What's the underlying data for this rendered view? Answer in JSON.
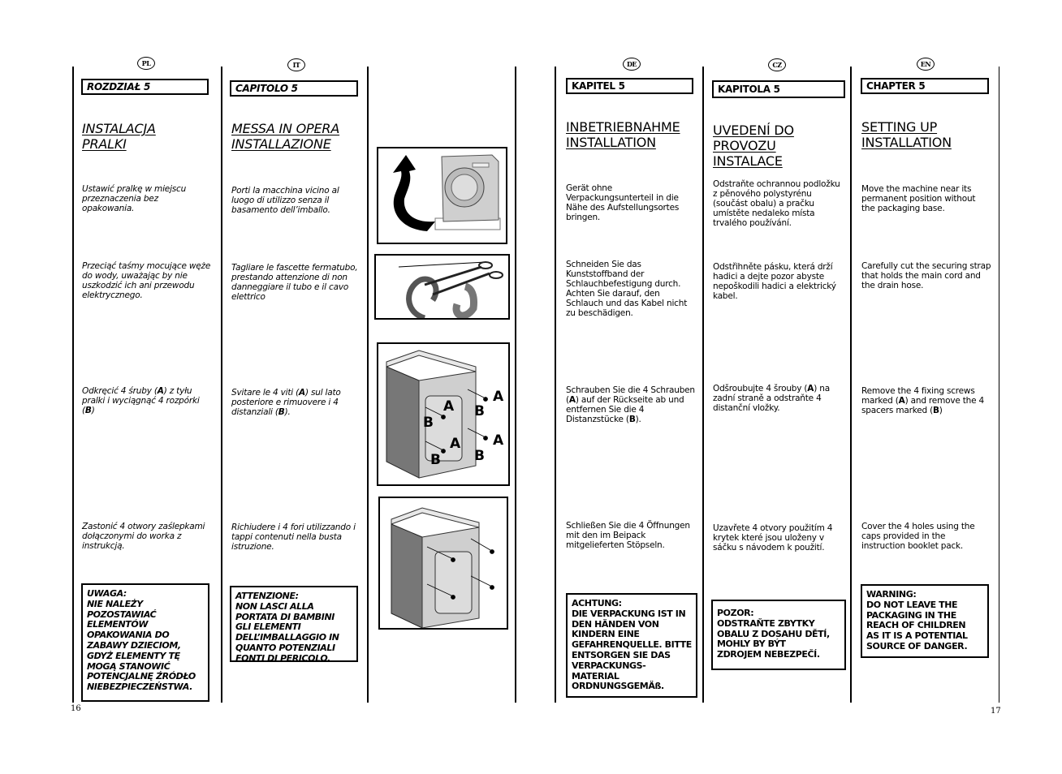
{
  "pages": {
    "left_number": "16",
    "right_number": "17"
  },
  "columns": [
    {
      "lang": "PL",
      "chapter": "ROZDZIAŁ 5",
      "title": [
        "INSTALACJA",
        "PRALKI"
      ],
      "steps": [
        "Ustawić pralkę w miejscu przeznaczenia bez opakowania.",
        "Przeciąć taśmy mocujące węże do wody, uważając by nie uszkodzić ich ani przewodu elektrycznego.",
        {
          "pre": "Odkręcić  4 śruby (",
          "a": "A",
          "mid": ") z tyłu pralki i wyciągnąć 4 rozpórki (",
          "b": "B",
          "post": ")"
        },
        "Zastonić  4 otwory zaślepkami dołączonymi do worka z instrukcją."
      ],
      "warning": [
        "UWAGA:",
        "NIE NALEŻY",
        "POZOSTAWIAĆ",
        "ELEMENTÓW",
        "OPAKOWANIA DO",
        "ZABAWY DZIECIOM,",
        "GDYŻ ELEMENTY TĘ",
        "MOGĄ STANOWIĆ",
        "POTENCJALNĘ ŹRÓDŁO",
        "NIEBEZPIECZEŃSTWA."
      ]
    },
    {
      "lang": "IT",
      "chapter": "CAPITOLO 5",
      "title": [
        "MESSA IN OPERA",
        "INSTALLAZIONE"
      ],
      "steps": [
        "Porti la macchina vicino al luogo di utilizzo senza il basamento dell’imballo.",
        "Tagliare le fascette fermatubo, prestando attenzione di non danneggiare il tubo e il cavo elettrico",
        {
          "pre": "Svitare le 4 viti (",
          "a": "A",
          "mid": ") sul lato posteriore e rimuovere i 4 distanziali (",
          "b": "B",
          "post": ")."
        },
        "Richiudere i 4 fori utilizzando i tappi contenuti nella busta istruzione."
      ],
      "warning": [
        "ATTENZIONE:",
        "NON LASCI ALLA",
        "PORTATA DI BAMBINI",
        "GLI ELEMENTI",
        "DELL’IMBALLAGGIO IN",
        "QUANTO POTENZIALI",
        "FONTI DI PERICOLO."
      ]
    },
    {
      "lang": "DE",
      "chapter": "KAPITEL 5",
      "title": [
        "INBETRIEBNAHME",
        "INSTALLATION"
      ],
      "steps": [
        "Gerät ohne Verpackungsunterteil in die Nähe des Aufstellungsortes bringen.",
        "Schneiden Sie das Kunststoffband der Schlauchbefestigung durch. Achten Sie darauf, den Schlauch und das Kabel nicht zu beschädigen.",
        {
          "pre": "Schrauben Sie die 4 Schrauben (",
          "a": "A",
          "mid": ") auf der Rückseite ab und entfernen Sie die 4 Distanzstücke (",
          "b": "B",
          "post": ")."
        },
        "Schließen Sie die 4 Öffnungen mit den im Beipack mitgelieferten Stöpseln."
      ],
      "warning": [
        "ACHTUNG:",
        "DIE VERPACKUNG IST IN",
        "DEN HÄNDEN VON",
        "KINDERN EINE",
        "GEFAHRENQUELLE. BITTE",
        "ENTSORGEN SIE DAS",
        "VERPACKUNGS-",
        "MATERIAL",
        "ORDNUNGSGEMÄß."
      ]
    },
    {
      "lang": "CZ",
      "chapter": "KAPITOLA 5",
      "title": [
        "UVEDENÍ DO",
        "PROVOZU",
        "INSTALACE"
      ],
      "steps": [
        "Odstraňte ochrannou podložku z pěnového polystyrénu (součást obalu) a pračku umístěte nedaleko místa trvalého používání.",
        "Odstřihněte pásku, která drží hadici a dejte pozor abyste nepoškodili hadici a elektrický kabel.",
        {
          "pre": "Odšroubujte 4 šrouby (",
          "a": "A",
          "mid": ") na zadní straně a odstraňte 4 distanční vložky.",
          "b": "",
          "post": ""
        },
        "Uzavřete 4 otvory použitím 4 krytek které jsou uloženy v sáčku s návodem k použití."
      ],
      "warning": [
        "POZOR:",
        "ODSTRAŇTE ZBYTKY",
        "OBALU Z DOSAHU DĚTÍ,",
        "MOHLY BY BÝT",
        "ZDROJEM NEBEZPEČÍ."
      ]
    },
    {
      "lang": "EN",
      "chapter": "CHAPTER 5",
      "title": [
        "SETTING UP",
        "INSTALLATION"
      ],
      "steps": [
        "Move the machine near its permanent position without the packaging base.",
        "Carefully cut the securing strap that holds the main cord and the drain hose.",
        {
          "pre": "Remove the 4 fixing screws marked (",
          "a": "A",
          "mid": ") and remove the 4 spacers marked (",
          "b": "B",
          "post": ")"
        },
        "Cover the 4 holes using the caps provided in the instruction booklet pack."
      ],
      "warning": [
        "WARNING:",
        "DO NOT LEAVE THE",
        "PACKAGING IN THE",
        "REACH OF CHILDREN",
        "AS IT IS A POTENTIAL",
        "SOURCE OF DANGER."
      ]
    }
  ],
  "figures": {
    "fig3_labels": [
      "A",
      "A",
      "A",
      "A",
      "B",
      "B",
      "B",
      "B"
    ]
  }
}
